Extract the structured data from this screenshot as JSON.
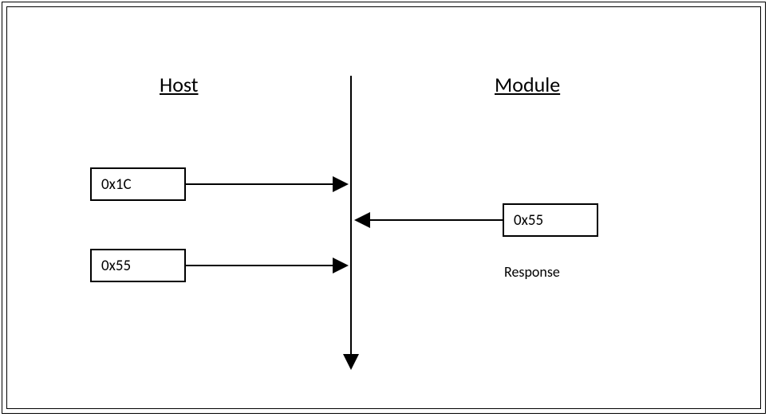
{
  "labels": {
    "host": "Host",
    "module": "Module",
    "response": "Response"
  },
  "host_messages": {
    "msg1": "0x1C",
    "msg2": "0x55"
  },
  "module_messages": {
    "msg1": "0x55"
  }
}
